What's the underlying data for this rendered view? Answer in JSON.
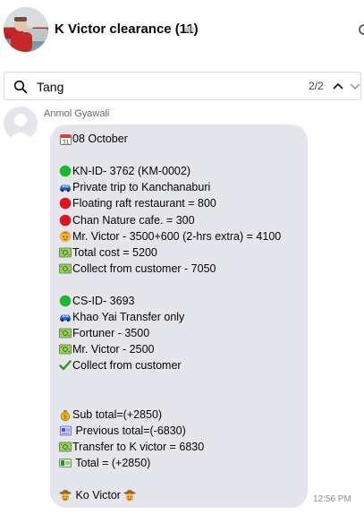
{
  "header": {
    "title": "K Victor clearance (11)"
  },
  "search": {
    "value": "Tang",
    "match_count": "2/2"
  },
  "message": {
    "sender": "Anmol Gyawali",
    "time": "12:56 PM",
    "lines": [
      {
        "icon": "calendar-icon",
        "text": "08 October"
      },
      {
        "icon": "",
        "text": ""
      },
      {
        "icon": "green-circle-icon",
        "text": "KN-ID- 3762 (KM-0002)"
      },
      {
        "icon": "car-icon",
        "text": "Private trip to Kanchanaburi"
      },
      {
        "icon": "red-circle-icon",
        "text": "Floating raft restaurant = 800"
      },
      {
        "icon": "red-circle-icon",
        "text": "Chan Nature cafe. = 300"
      },
      {
        "icon": "person-icon",
        "text": "Mr. Victor - 3500+600 (2-hrs extra) = 4100"
      },
      {
        "icon": "money-icon",
        "text": "Total cost = 5200"
      },
      {
        "icon": "money-icon",
        "text": "Collect from customer - 7050"
      },
      {
        "icon": "",
        "text": ""
      },
      {
        "icon": "green-circle-icon",
        "text": "CS-ID- 3693"
      },
      {
        "icon": "car-icon",
        "text": "Khao Yai Transfer only"
      },
      {
        "icon": "money-icon",
        "text": "Fortuner - 3500"
      },
      {
        "icon": "money-icon",
        "text": "Mr. Victor - 2500"
      },
      {
        "icon": "checkmark-icon",
        "text": "Collect from customer"
      },
      {
        "icon": "",
        "text": ""
      },
      {
        "icon": "",
        "text": ""
      },
      {
        "icon": "money-bag-icon",
        "text": "Sub total=(+2850)"
      },
      {
        "icon": "receipt-icon",
        "text": " Previous total=(-6830)"
      },
      {
        "icon": "money-icon",
        "text": "Transfer to K victor = 6830"
      },
      {
        "icon": "banknote-icon",
        "text": " Total = (+2850)"
      },
      {
        "icon": "",
        "text": ""
      },
      {
        "icon": "cowboy-face-icon",
        "text": " Ko Victor ",
        "trail_icon": "cowboy-face-icon"
      }
    ]
  }
}
